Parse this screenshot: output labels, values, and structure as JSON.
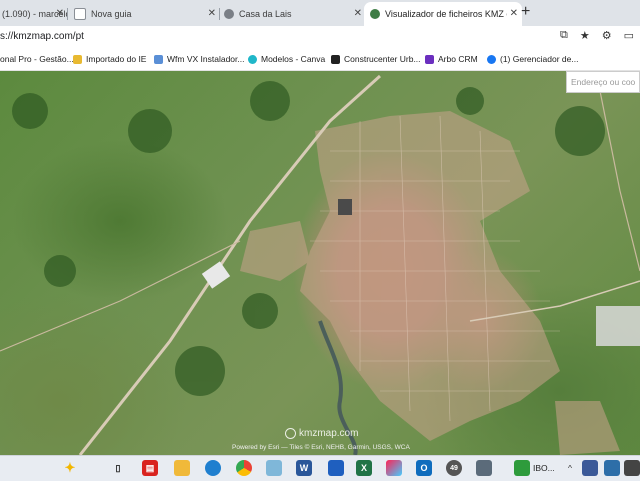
{
  "tabs": [
    {
      "label": "(1.090) - marcelo",
      "fav_color": "#d33b2f",
      "active": false
    },
    {
      "label": "Nova guia",
      "fav_color": "#8a8f96",
      "active": false
    },
    {
      "label": "Casa da Lais",
      "fav_color": "#7a7f86",
      "active": false
    },
    {
      "label": "Visualizador de ficheiros KMZ e KML",
      "fav_color": "#3f7d46",
      "active": true
    }
  ],
  "url": "s://kmzmap.com/pt",
  "bookmarks": [
    {
      "label": "onal Pro - Gestão...",
      "color": "#d24a2b"
    },
    {
      "label": "Importado do IE",
      "color": "#e8b931"
    },
    {
      "label": "Wfm VX Instalador...",
      "color": "#5a8fd6"
    },
    {
      "label": "Modelos - Canva",
      "color": "#20b7c9"
    },
    {
      "label": "Construcenter Urb...",
      "color": "#222222"
    },
    {
      "label": "Arbo CRM",
      "color": "#6b2fbf"
    },
    {
      "label": "(1) Gerenciador de...",
      "color": "#1877f2"
    }
  ],
  "map": {
    "search_placeholder": "Endereço ou coo",
    "watermark": "kmzmap.com",
    "credit": "Powered by Esri — Tiles © Esri, NEHB, Garmin, USGS, WCA"
  },
  "taskbar": {
    "weather_label": "IBO...",
    "badge": "49"
  }
}
